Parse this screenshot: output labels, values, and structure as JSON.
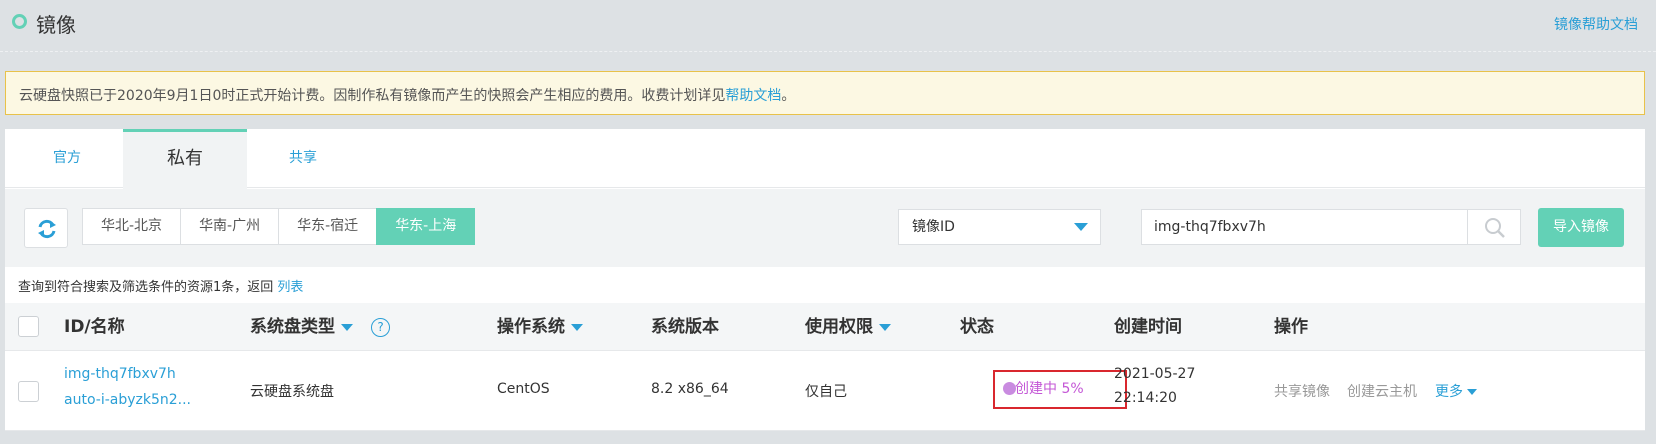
{
  "header": {
    "title": "镜像",
    "help_link": "镜像帮助文档"
  },
  "notice": {
    "text": "云硬盘快照已于2020年9月1日0时正式开始计费。因制作私有镜像而产生的快照会产生相应的费用。收费计划详见",
    "link": "帮助文档",
    "suffix": "。"
  },
  "tabs": [
    {
      "label": "官方",
      "active": false
    },
    {
      "label": "私有",
      "active": true
    },
    {
      "label": "共享",
      "active": false
    }
  ],
  "toolbar": {
    "regions": [
      {
        "label": "华北-北京",
        "active": false
      },
      {
        "label": "华南-广州",
        "active": false
      },
      {
        "label": "华东-宿迁",
        "active": false
      },
      {
        "label": "华东-上海",
        "active": true
      }
    ],
    "filter_select": "镜像ID",
    "search_value": "img-thq7fbxv7h",
    "import_button": "导入镜像"
  },
  "result": {
    "text": "查询到符合搜索及筛选条件的资源1条，返回",
    "link": "列表"
  },
  "table": {
    "headers": {
      "id_name": "ID/名称",
      "disk_type": "系统盘类型",
      "os": "操作系统",
      "version": "系统版本",
      "permission": "使用权限",
      "status": "状态",
      "created": "创建时间",
      "actions": "操作"
    },
    "rows": [
      {
        "id": "img-thq7fbxv7h",
        "name": "auto-i-abyzk5n2...",
        "disk_type": "云硬盘系统盘",
        "os": "CentOS",
        "version": "8.2 x86_64",
        "permission": "仅自己",
        "status": "创建中 5%",
        "created_date": "2021-05-27",
        "created_time": "22:14:20",
        "actions": [
          "共享镜像",
          "创建云主机",
          "更多"
        ]
      }
    ]
  },
  "colors": {
    "accent": "#63d1b6",
    "link": "#2a9fd6",
    "status": "#c457d6",
    "highlight_border": "#d9272e"
  }
}
